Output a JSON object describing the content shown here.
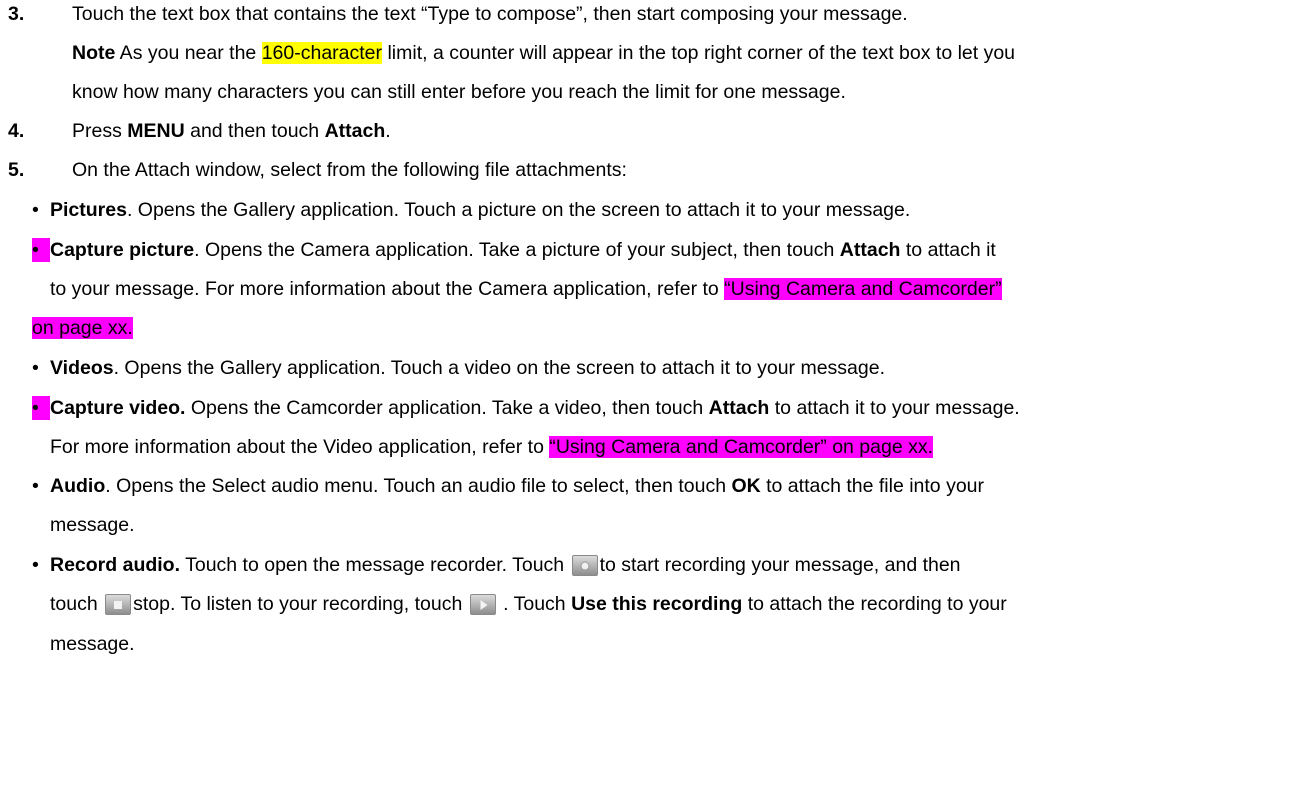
{
  "steps": [
    {
      "num": "3.",
      "text": "Touch the text box that contains the text “Type to compose”, then start composing your message.",
      "note_label": "Note",
      "note_pre": " As you near the ",
      "note_highlight": "160-character",
      "note_post": " limit, a counter will appear in the top right corner of the text box to let you",
      "note_line2": "know how many characters you can still enter before you reach the limit for one message."
    },
    {
      "num": "4.",
      "pre": "Press ",
      "menu": "MENU",
      "mid": " and then touch ",
      "attach": "Attach",
      "post": "."
    },
    {
      "num": "5.",
      "text": "On the Attach window, select from the following file attachments:"
    }
  ],
  "bullets": {
    "symbol": "•",
    "pictures": {
      "label": "Pictures",
      "text": ". Opens the Gallery application. Touch a picture on the screen to attach it to your message."
    },
    "capture_picture": {
      "label": "Capture picture",
      "text1": ". Opens the Camera application. Take a picture of your subject, then touch ",
      "attach": "Attach",
      "text2": " to attach it",
      "line2": "to your message. For more information about the Camera application, refer to ",
      "ref_line2": " “Using Camera and Camcorder”",
      "ref_line3": "on page xx."
    },
    "videos": {
      "label": "Videos",
      "text": ". Opens the Gallery application. Touch a video on the screen to attach it to your message."
    },
    "capture_video": {
      "label": "Capture video.",
      "text1": " Opens the Camcorder application. Take a video, then touch ",
      "attach": "Attach",
      "text2": " to attach it to your message.",
      "line2": "For more information about the Video application, refer to ",
      "ref": " “Using Camera and  Camcorder” on page xx."
    },
    "audio": {
      "label": "Audio",
      "text1": ". Opens the Select audio menu. Touch an audio file to select, then touch ",
      "ok": "OK",
      "text2": " to attach the file into your",
      "line2": "message."
    },
    "record_audio": {
      "label": "Record audio.",
      "text1": " Touch to open the message recorder. Touch ",
      "text2": "to start recording your message, and then",
      "line2_a": "touch ",
      "line2_b": "stop. To listen to your recording, touch ",
      "line2_c": " . Touch ",
      "use_rec": "Use this recording",
      "line2_d": " to attach the recording to your",
      "line3": "message."
    }
  },
  "icons": {
    "record": "record-button-icon",
    "stop": "stop-button-icon",
    "play": "play-button-icon"
  },
  "colors": {
    "yellow_highlight": "#ffff00",
    "magenta_highlight": "#ff00ff"
  }
}
